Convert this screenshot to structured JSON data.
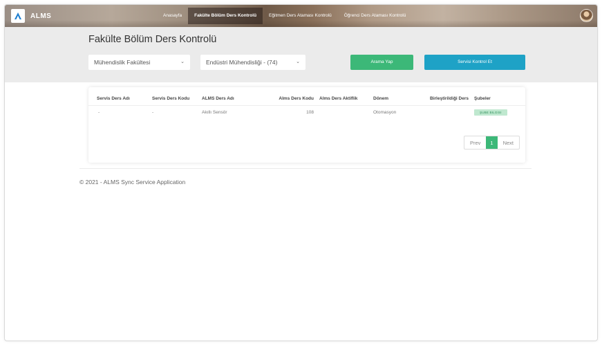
{
  "brand": {
    "name": "ALMS"
  },
  "nav": {
    "items": [
      {
        "label": "Anasayfa"
      },
      {
        "label": "Fakülte Bölüm Ders Kontrolü"
      },
      {
        "label": "Eğitmen Ders Ataması Kontrolü"
      },
      {
        "label": "Öğrenci Ders Ataması Kontrolü"
      }
    ],
    "active_index": 1
  },
  "page": {
    "title": "Fakülte Bölüm Ders Kontrolü"
  },
  "filters": {
    "faculty": {
      "selected": "Mühendislik Fakültesi"
    },
    "department": {
      "selected": "Endüstri Mühendisliği - (74)"
    }
  },
  "actions": {
    "search_label": "Arama Yap",
    "check_service_label": "Servisi Kontrol Et"
  },
  "table": {
    "headers": [
      "Servis Ders Adı",
      "Servis Ders Kodu",
      "ALMS Ders Adı",
      "Alms Ders Kodu",
      "Alms Ders Aktiflik",
      "Dönem",
      "Birleştirildiği Ders",
      "Şubeler"
    ],
    "rows": [
      {
        "servis_ders_adi": "-",
        "servis_ders_kodu": "-",
        "alms_ders_adi": "Akıllı Sensör",
        "alms_ders_kodu": "108",
        "alms_ders_aktiflik": "",
        "donem": "Otomasyon",
        "birlestirildigi_ders": "",
        "subeler": "ŞUBE BILGISI"
      }
    ]
  },
  "pagination": {
    "prev": "Prev",
    "current": "1",
    "next": "Next"
  },
  "footer": {
    "text": "© 2021 - ALMS Sync Service Application"
  },
  "colors": {
    "green": "#3cb878",
    "teal": "#1ea2c6",
    "band": "#ebebeb"
  },
  "icons": {
    "logo": "alms-logo-icon",
    "select": "chevron-down-icon",
    "avatar": "user-avatar"
  }
}
